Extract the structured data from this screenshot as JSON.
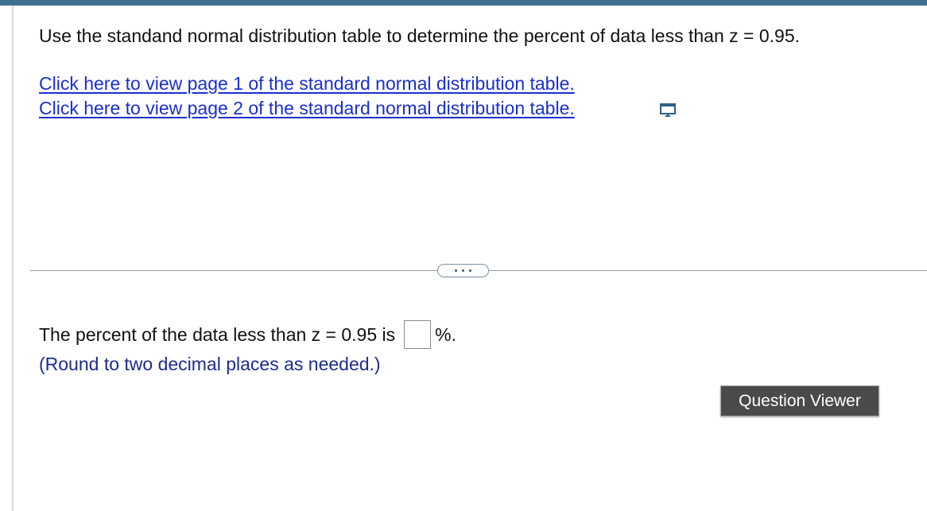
{
  "question": {
    "prompt": "Use the standand normal distribution table to determine the percent of data less than z = 0.95."
  },
  "links": [
    {
      "label": "Click here to view page 1 of the standard normal distribution table."
    },
    {
      "label": "Click here to view page 2 of the standard normal distribution table."
    }
  ],
  "icons": {
    "popup": "popup-window-icon",
    "more": "ellipsis-icon"
  },
  "answer": {
    "prefix": "The percent of the data less than z = 0.95 is",
    "value": "",
    "suffix": "%.",
    "hint": "(Round to two decimal places as needed.)"
  },
  "buttons": {
    "question_viewer": "Question Viewer"
  },
  "colors": {
    "top_bar": "#3d6f93",
    "link": "#1a2fd1",
    "hint": "#1d2b8f",
    "button_bg": "#4a4a4a"
  }
}
